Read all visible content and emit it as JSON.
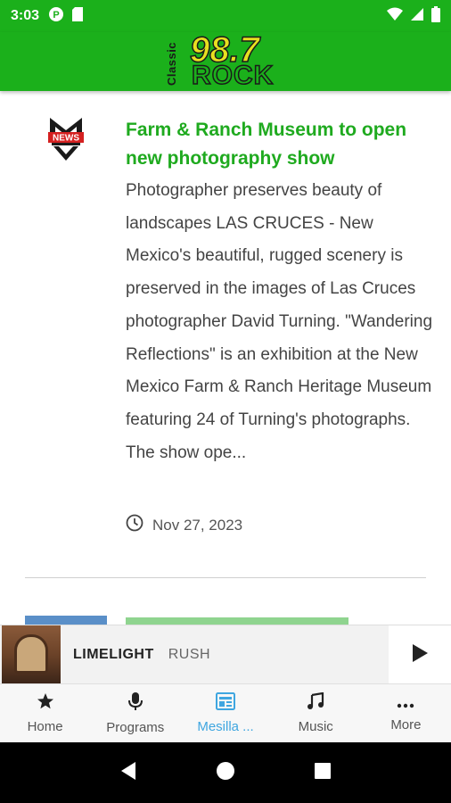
{
  "status_bar": {
    "time": "3:03"
  },
  "header": {
    "logo_text_classic": "Classic",
    "logo_text_number": "98.7",
    "logo_text_rock": "ROCK"
  },
  "article": {
    "title": "Farm & Ranch Museum to open new photography show",
    "body": "Photographer preserves beauty of landscapes LAS CRUCES - New Mexico's beautiful, rugged scenery is preserved in the images of Las Cruces photographer David Turning. \"Wandering Reflections\" is an exhibition at the New Mexico Farm & Ranch Heritage Museum featuring 24 of Turning's photographs. The show ope...",
    "date": "Nov 27, 2023",
    "source_logo_text": "NEWS"
  },
  "player": {
    "track": "LIMELIGHT",
    "artist": "RUSH"
  },
  "nav": {
    "items": [
      {
        "label": "Home",
        "icon": "star-icon"
      },
      {
        "label": "Programs",
        "icon": "microphone-icon"
      },
      {
        "label": "Mesilla ...",
        "icon": "news-icon"
      },
      {
        "label": "Music",
        "icon": "music-note-icon"
      },
      {
        "label": "More",
        "icon": "more-icon"
      }
    ],
    "active_index": 2
  },
  "colors": {
    "brand_green": "#1bb01b",
    "title_green": "#1faa1f",
    "active_blue": "#3fa6e0"
  }
}
